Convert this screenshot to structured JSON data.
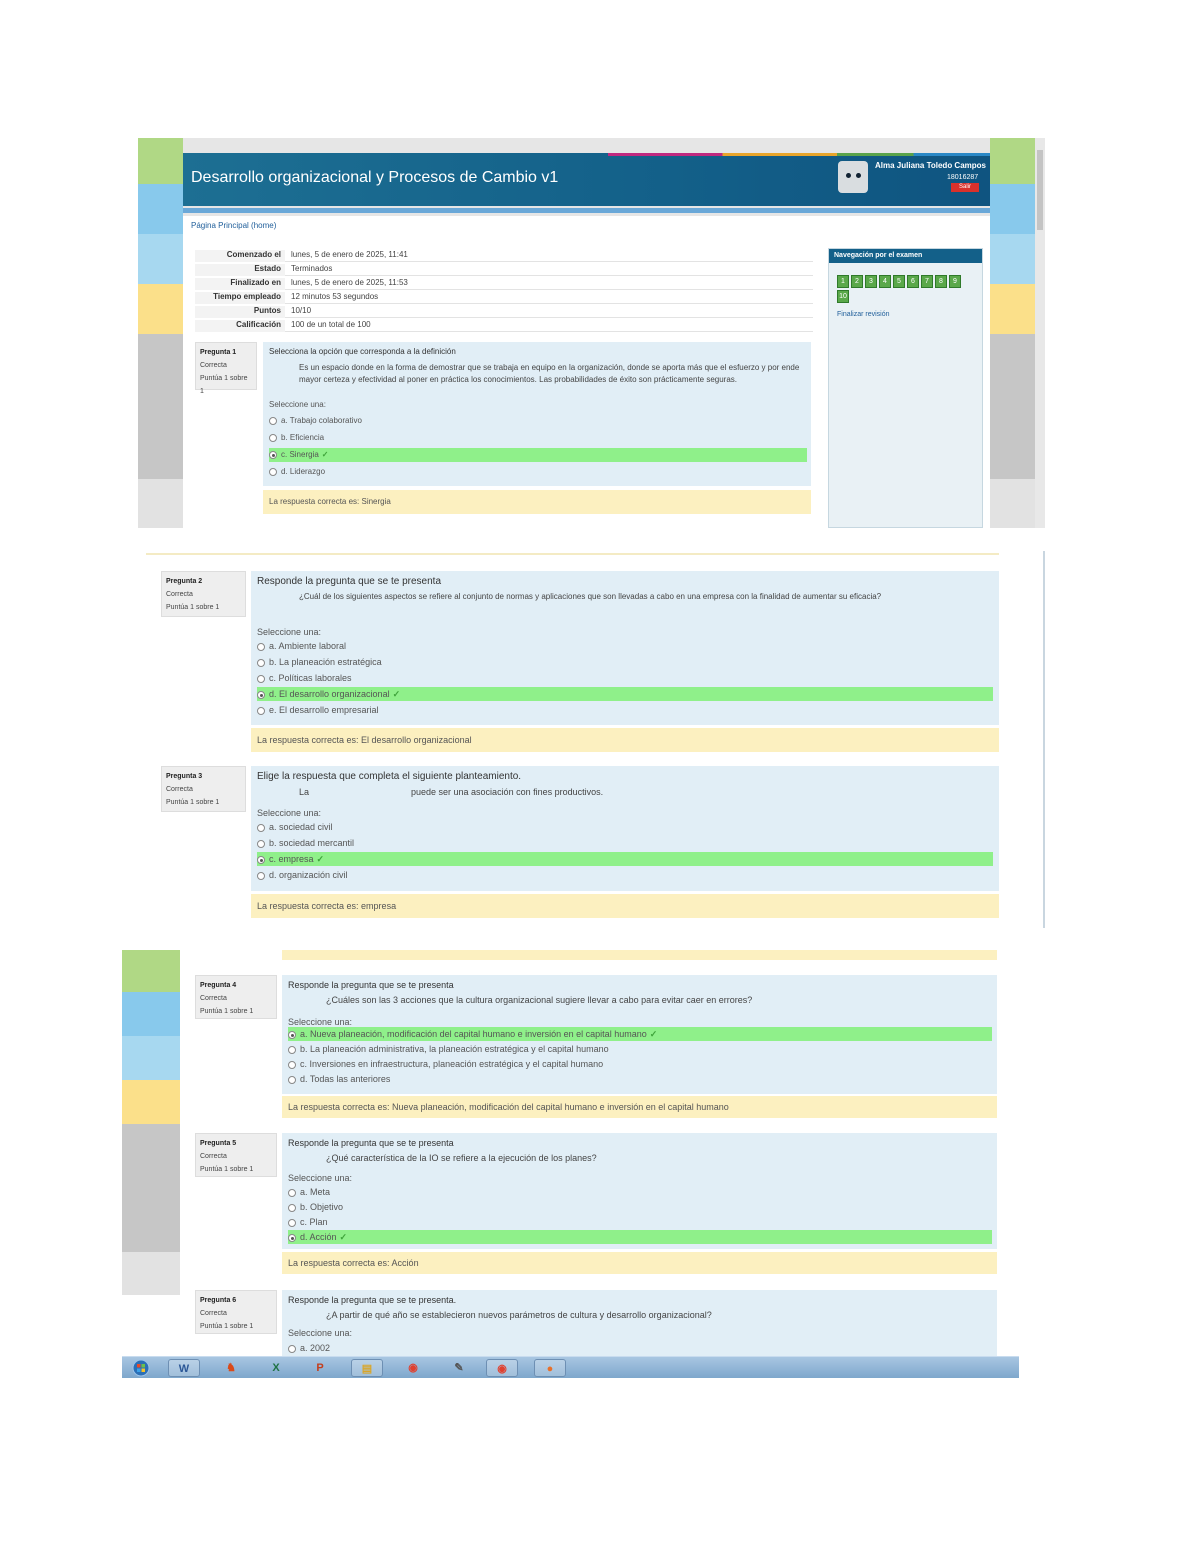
{
  "course": {
    "title": "Desarrollo organizacional y Procesos de Cambio v1",
    "user_name": "Alma Juliana Toledo Campos",
    "user_id": "18016287",
    "logout_label": "Salir",
    "breadcrumb": "Página Principal (home)"
  },
  "summary": [
    {
      "label": "Comenzado el",
      "value": "lunes, 5 de enero de 2025, 11:41"
    },
    {
      "label": "Estado",
      "value": "Terminados"
    },
    {
      "label": "Finalizado en",
      "value": "lunes, 5 de enero de 2025, 11:53"
    },
    {
      "label": "Tiempo empleado",
      "value": "12 minutos 53 segundos"
    },
    {
      "label": "Puntos",
      "value": "10/10"
    },
    {
      "label": "Calificación",
      "value": "100 de un total de 100"
    }
  ],
  "quiz_nav": {
    "title": "Navegación por el examen",
    "buttons": [
      "1",
      "2",
      "3",
      "4",
      "5",
      "6",
      "7",
      "8",
      "9",
      "10"
    ],
    "finish_label": "Finalizar revisión"
  },
  "questions": [
    {
      "number_label": "Pregunta 1",
      "status": "Correcta",
      "points": "Puntúa 1 sobre 1",
      "prompt": "Selecciona la opción que corresponda a la definición",
      "description": "Es un espacio donde en la forma de demostrar que se trabaja en equipo en la organización, donde se aporta más que el esfuerzo y por ende mayor certeza y efectividad al poner en práctica los conocimientos. Las probabilidades de éxito son prácticamente seguras.",
      "select_label": "Seleccione una:",
      "options": [
        {
          "text": "a. Trabajo colaborativo",
          "correct": false
        },
        {
          "text": "b. Eficiencia",
          "correct": false
        },
        {
          "text": "c. Sinergia",
          "correct": true
        },
        {
          "text": "d. Liderazgo",
          "correct": false
        }
      ],
      "feedback": "La respuesta correcta es: Sinergia"
    },
    {
      "number_label": "Pregunta 2",
      "status": "Correcta",
      "points": "Puntúa 1 sobre 1",
      "prompt": "Responde la pregunta que se te presenta",
      "description": "¿Cuál de los siguientes aspectos se refiere al conjunto de normas y aplicaciones que son llevadas a cabo en una empresa con la finalidad de aumentar su eficacia?",
      "select_label": "Seleccione una:",
      "options": [
        {
          "text": "a. Ambiente laboral",
          "correct": false
        },
        {
          "text": "b. La planeación estratégica",
          "correct": false
        },
        {
          "text": "c. Políticas laborales",
          "correct": false
        },
        {
          "text": "d. El desarrollo organizacional",
          "correct": true
        },
        {
          "text": "e. El desarrollo empresarial",
          "correct": false
        }
      ],
      "feedback": "La respuesta correcta es: El desarrollo organizacional"
    },
    {
      "number_label": "Pregunta 3",
      "status": "Correcta",
      "points": "Puntúa 1 sobre 1",
      "prompt": "Elige la respuesta que completa el siguiente planteamiento.",
      "description_left": "La",
      "description_right": "puede ser una asociación con fines productivos.",
      "select_label": "Seleccione una:",
      "options": [
        {
          "text": "a. sociedad civil",
          "correct": false
        },
        {
          "text": "b. sociedad mercantil",
          "correct": false
        },
        {
          "text": "c. empresa",
          "correct": true
        },
        {
          "text": "d. organización civil",
          "correct": false
        }
      ],
      "feedback": "La respuesta correcta es: empresa"
    },
    {
      "number_label": "Pregunta 4",
      "status": "Correcta",
      "points": "Puntúa 1 sobre 1",
      "prompt": "Responde la pregunta que se te presenta",
      "description": "¿Cuáles son las 3 acciones que la cultura organizacional sugiere llevar a cabo para evitar caer en errores?",
      "select_label": "Seleccione una:",
      "options": [
        {
          "text": "a. Nueva planeación, modificación del capital humano e inversión en el capital humano",
          "correct": true
        },
        {
          "text": "b. La planeación administrativa, la planeación estratégica y el capital humano",
          "correct": false
        },
        {
          "text": "c. Inversiones en infraestructura, planeación estratégica y el capital humano",
          "correct": false
        },
        {
          "text": "d. Todas las anteriores",
          "correct": false
        }
      ],
      "feedback": "La respuesta correcta es: Nueva planeación, modificación del capital humano e inversión en el capital humano"
    },
    {
      "number_label": "Pregunta 5",
      "status": "Correcta",
      "points": "Puntúa 1 sobre 1",
      "prompt": "Responde la pregunta que se te presenta",
      "description": "¿Qué característica de la IO se refiere a la ejecución de los planes?",
      "select_label": "Seleccione una:",
      "options": [
        {
          "text": "a. Meta",
          "correct": false
        },
        {
          "text": "b. Objetivo",
          "correct": false
        },
        {
          "text": "c. Plan",
          "correct": false
        },
        {
          "text": "d. Acción",
          "correct": true
        }
      ],
      "feedback": "La respuesta correcta es: Acción"
    },
    {
      "number_label": "Pregunta 6",
      "status": "Correcta",
      "points": "Puntúa 1 sobre 1",
      "prompt": "Responde la pregunta que se te presenta.",
      "description": "¿A partir de qué año se establecieron nuevos parámetros de cultura y desarrollo organizacional?",
      "select_label": "Seleccione una:",
      "options": [
        {
          "text": "a. 2002",
          "correct": false
        }
      ]
    }
  ],
  "taskbar": {
    "items": [
      {
        "icon": "start-orb-icon"
      },
      {
        "icon": "word-icon",
        "glyph": "W"
      },
      {
        "icon": "bird-app-icon",
        "glyph": "♞"
      },
      {
        "icon": "excel-icon",
        "glyph": "X"
      },
      {
        "icon": "powerpoint-icon",
        "glyph": "P"
      },
      {
        "icon": "folder-icon",
        "glyph": "▤"
      },
      {
        "icon": "chrome-icon",
        "glyph": "◉"
      },
      {
        "icon": "paint-icon",
        "glyph": "✎"
      },
      {
        "icon": "chrome-window-icon",
        "glyph": "◉"
      },
      {
        "icon": "firefox-icon",
        "glyph": "●"
      }
    ]
  },
  "colors": {
    "header": "#136089",
    "correct_option": "#8ff08a",
    "question_box": "#e1eef6",
    "feedback": "#fcf0c0",
    "stripe_green": "#b0d885",
    "stripe_blue": "#88c9ec",
    "stripe_lightblue": "#a7d8f0",
    "stripe_yellow": "#fbe08a",
    "stripe_grey": "#c6c6c6"
  }
}
